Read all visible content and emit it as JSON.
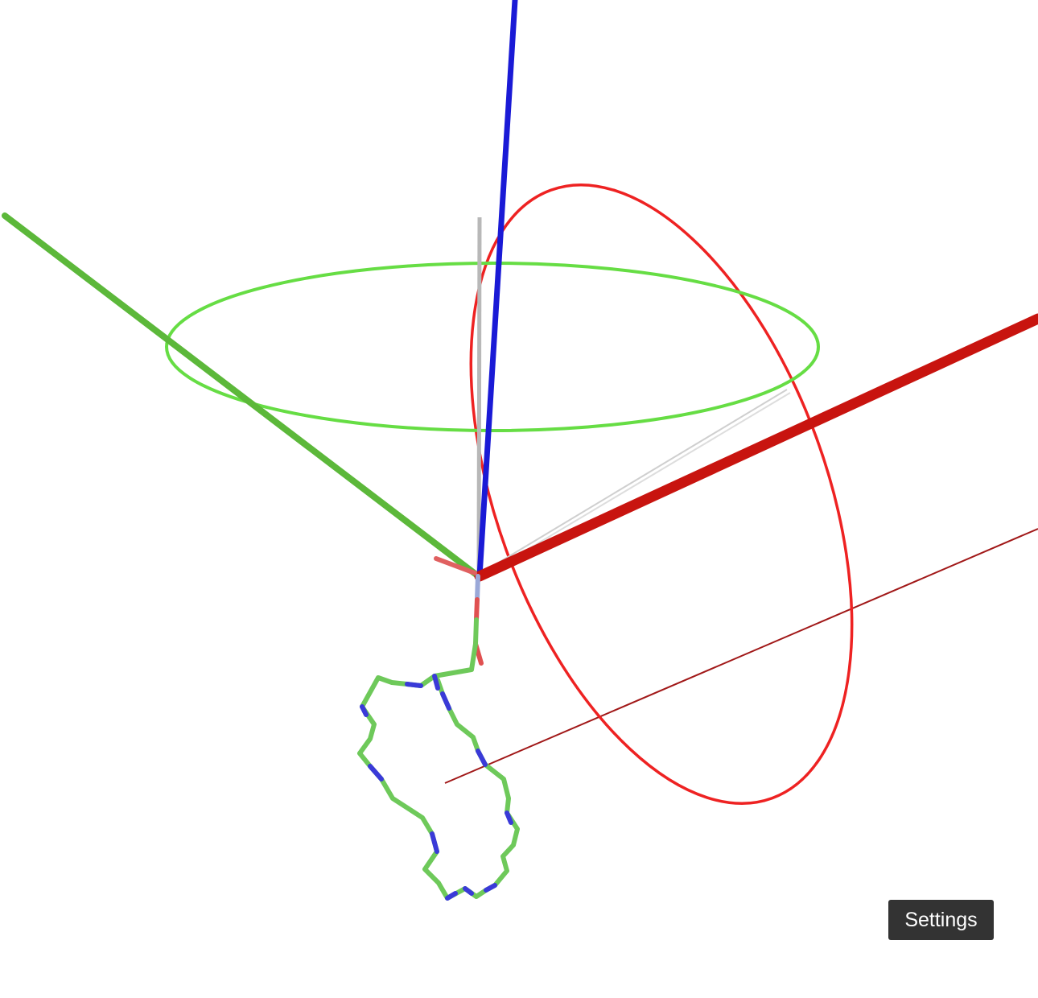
{
  "viewer": {
    "background_color": "#ffffff"
  },
  "scene": {
    "axes": [
      {
        "name": "x-axis",
        "color": "#c8140f"
      },
      {
        "name": "y-axis",
        "color": "#5cb83a"
      },
      {
        "name": "z-axis",
        "color": "#1a1ad6"
      }
    ],
    "rotation_rings": [
      {
        "name": "y-rotation-ring",
        "color": "#66dd44"
      },
      {
        "name": "x-rotation-ring",
        "color": "#ee2222"
      }
    ],
    "molecule": {
      "representation": "sticks",
      "carbon_color": "#6ec95a",
      "nitrogen_color": "#3a3ad8",
      "oxygen_color": "#e05050"
    }
  },
  "controls": {
    "settings_label": "Settings"
  }
}
